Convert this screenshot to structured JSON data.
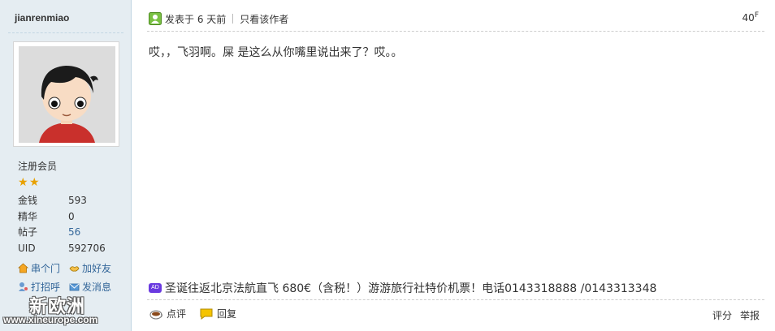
{
  "user": {
    "name": "jianrenmiao",
    "group": "注册会员",
    "stats": [
      {
        "key": "金钱",
        "value": "593"
      },
      {
        "key": "精华",
        "value": "0"
      },
      {
        "key": "帖子",
        "value": "56"
      },
      {
        "key": "UID",
        "value": "592706"
      }
    ],
    "actions": {
      "visit": "串个门",
      "add_friend": "加好友",
      "greet": "打招呼",
      "message": "发消息"
    }
  },
  "watermark": {
    "title": "新欧洲",
    "url": "www.xineurope.com"
  },
  "post": {
    "posted_label": "发表于 6 天前",
    "author_only": "只看该作者",
    "floor_num": "40",
    "floor_suffix": "F",
    "body": "哎，，飞羽啊。屎  是这么从你嘴里说出来了？哎。。",
    "ad_badge": "AD",
    "ad_text": "圣诞往返北京法航直飞 680€（含税！）游游旅行社特价机票！电话0143318888 /0143313348"
  },
  "footer": {
    "rate": "点评",
    "reply": "回复",
    "score": "评分",
    "report": "举报"
  },
  "colors": {
    "sidebar_bg": "#e5edf2",
    "link": "#336699",
    "ad_badge": "#6a3ae0"
  }
}
